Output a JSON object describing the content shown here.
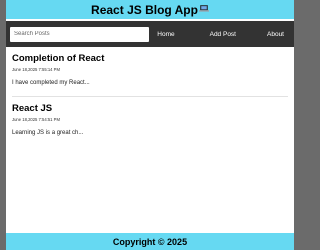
{
  "header": {
    "title": "React JS Blog App",
    "icon": "laptop-icon"
  },
  "nav": {
    "search_placeholder": "Search Posts",
    "links": [
      "Home",
      "Add Post",
      "About"
    ]
  },
  "posts": [
    {
      "title": "Completion of React",
      "date": "June 18,2025 7:55:14 PM",
      "body": "I have completed my React..."
    },
    {
      "title": "React JS",
      "date": "June 18,2025 7:54:51 PM",
      "body": "Learning JS is a great ch..."
    }
  ],
  "footer": {
    "text": "Copyright © 2025"
  },
  "colors": {
    "header_bg": "#66d9f2",
    "nav_bg": "#333333",
    "page_bg": "#6b6b6b"
  }
}
